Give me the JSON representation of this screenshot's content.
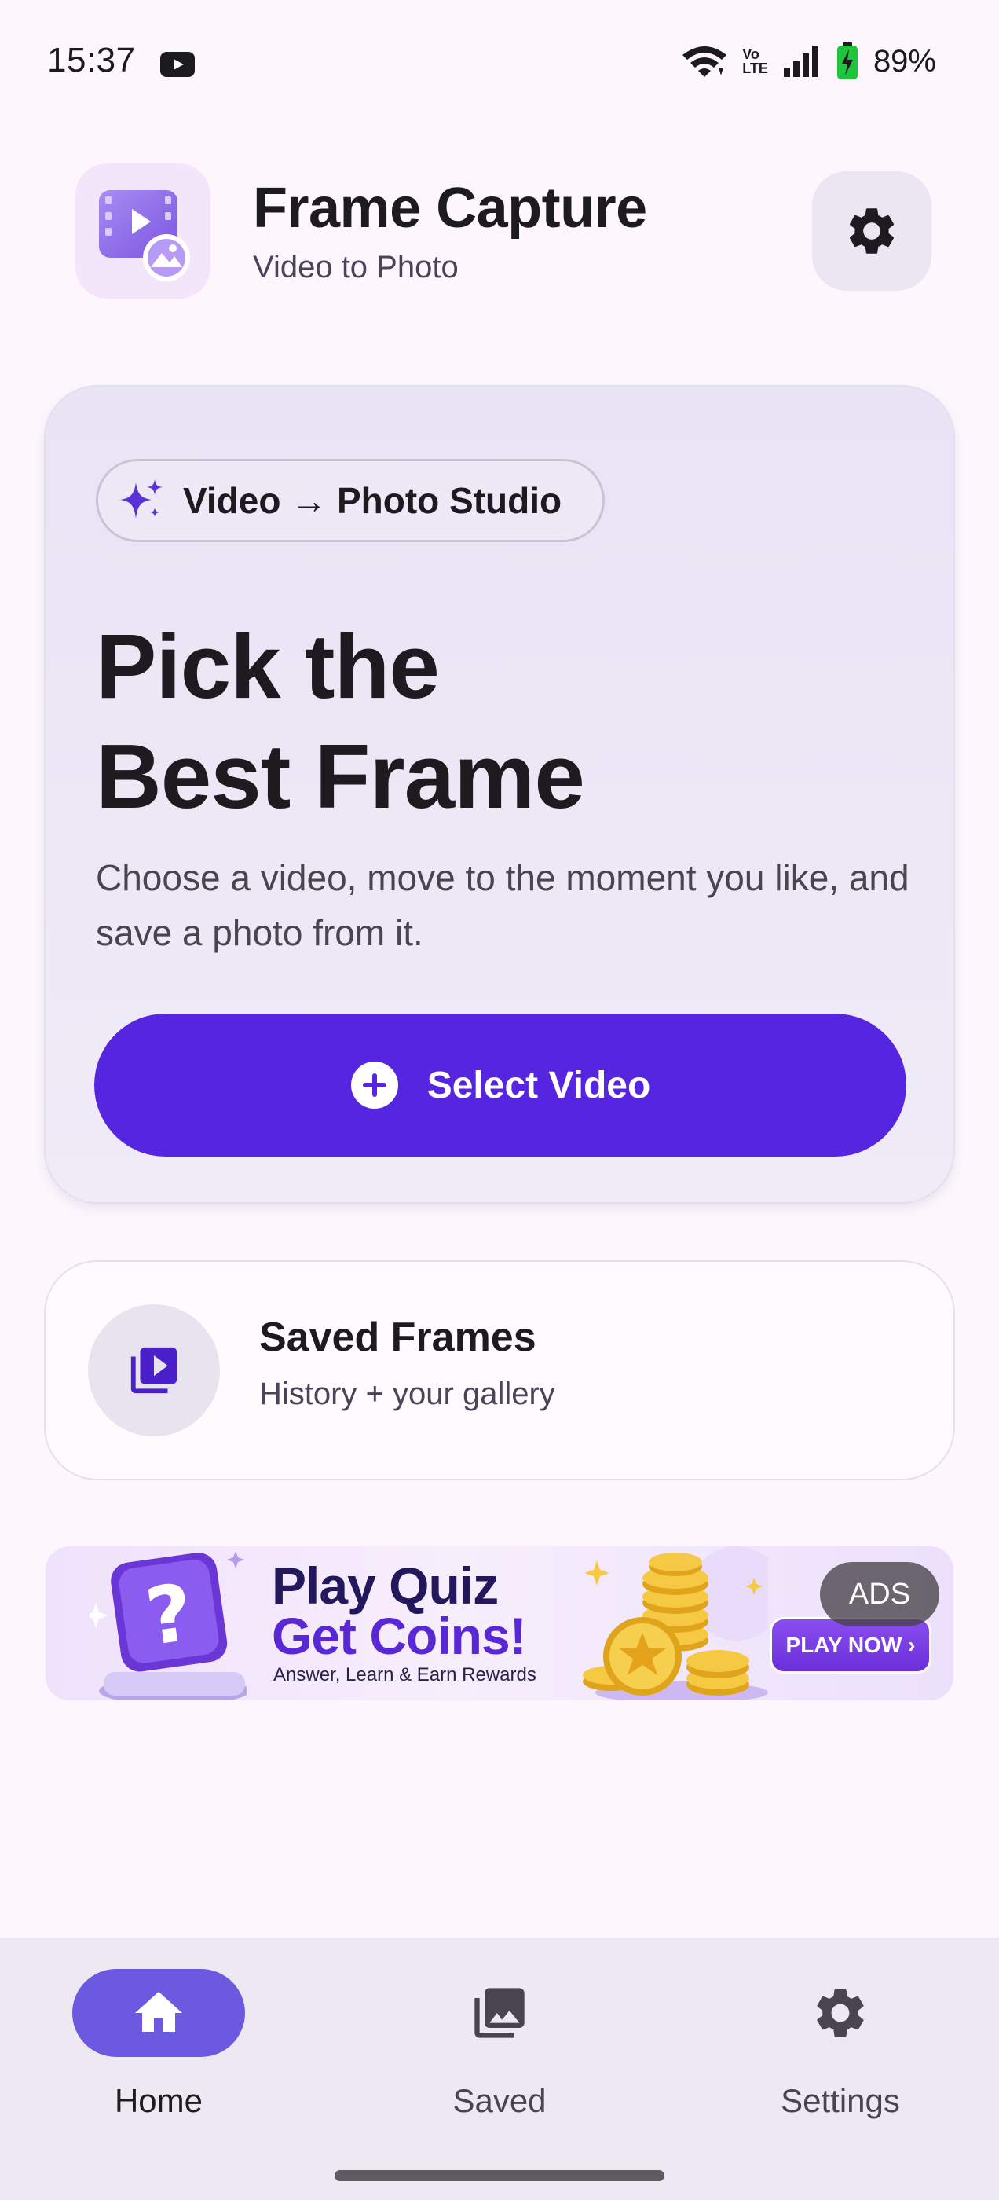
{
  "status_bar": {
    "time": "15:37",
    "network": "Vo LTE",
    "volte_top": "Vo",
    "volte_bottom": "LTE",
    "battery": "89%"
  },
  "header": {
    "title": "Frame Capture",
    "subtitle": "Video to Photo"
  },
  "hero": {
    "badge": "Video → Photo Studio",
    "title_line1": "Pick the",
    "title_line2": "Best Frame",
    "description": "Choose a video, move to the moment you like, and save a photo from it.",
    "button": "Select Video"
  },
  "saved_card": {
    "title": "Saved Frames",
    "subtitle": "History + your gallery"
  },
  "ad": {
    "headline_1": "Play Quiz",
    "headline_2": "Get Coins!",
    "tagline": "Answer, Learn & Earn Rewards",
    "cta": "PLAY NOW ›",
    "tag": "ADS"
  },
  "bottom_nav": {
    "items": [
      {
        "label": "Home",
        "icon": "home-icon",
        "active": true
      },
      {
        "label": "Saved",
        "icon": "photo-library-icon",
        "active": false
      },
      {
        "label": "Settings",
        "icon": "gear-icon",
        "active": false
      }
    ]
  },
  "colors": {
    "primary": "#5525e0",
    "nav_active": "#6b5ae0",
    "background": "#fdf7fd",
    "card": "#ece7f5"
  }
}
